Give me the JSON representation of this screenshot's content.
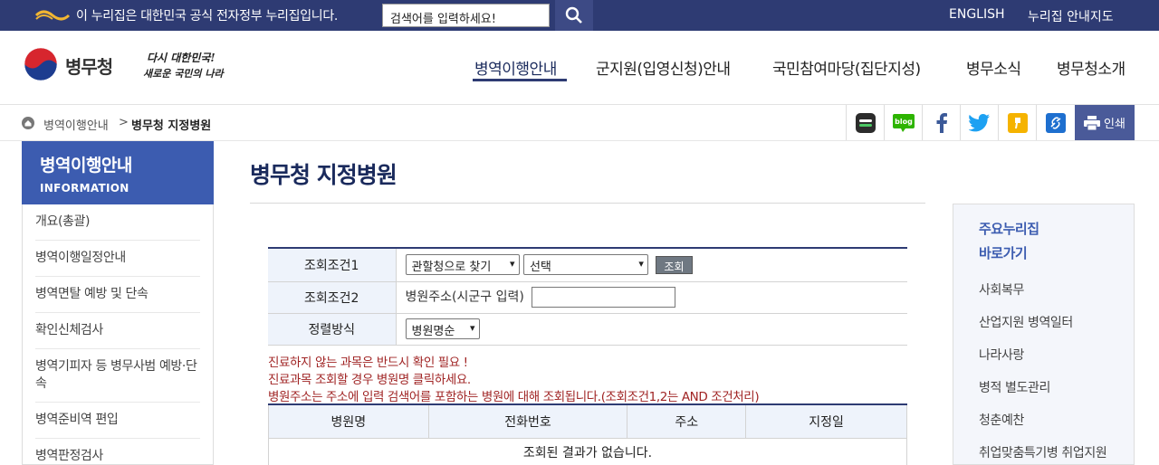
{
  "topbar": {
    "gov_notice": "이 누리집은 대한민국 공식 전자정부 누리집입니다.",
    "search_placeholder": "검색어를 입력하세요!",
    "links": [
      "ENGLISH",
      "누리집 안내지도"
    ]
  },
  "header": {
    "logo_text": "병무청",
    "slogan_line1": "다시 대한민국!",
    "slogan_line2": "새로운 국민의 나라",
    "gnb": [
      "병역이행안내",
      "군지원(입영신청)안내",
      "국민참여마당(집단지성)",
      "병무소식",
      "병무청소개"
    ]
  },
  "breadcrumb": [
    "병역이행안내",
    ">",
    "병무청 지정병원"
  ],
  "share": {
    "print_label": "인쇄"
  },
  "lnb": {
    "title": "병역이행안내",
    "subtitle": "INFORMATION",
    "items": [
      "개요(총괄)",
      "병역이행일정안내",
      "병역면탈 예방 및 단속",
      "확인신체검사",
      "병역기피자 등 병무사범 예방·단속",
      "병역준비역 편입",
      "병역판정검사"
    ]
  },
  "main": {
    "title": "병무청 지정병원",
    "search": {
      "row1_label": "조회조건1",
      "row1_select1": "관할청으로 찾기",
      "row1_select2": "선택",
      "row1_button": "조회",
      "row2_label": "조회조건2",
      "row2_text": "병원주소(시군구 입력)",
      "row3_label": "정렬방식",
      "row3_select": "병원명순"
    },
    "notices": [
      "진료하지 않는 과목은 반드시 확인 필요 !",
      "진료과목 조회할 경우 병원명 클릭하세요.",
      "병원주소는 주소에 입력 검색어를 포함하는 병원에 대해 조회됩니다.(조회조건1,2는 AND 조건처리)"
    ],
    "result_headers": [
      "병원명",
      "전화번호",
      "주소",
      "지정일"
    ],
    "empty_message": "조회된 결과가 없습니다."
  },
  "quick": {
    "title_line1": "주요누리집",
    "title_line2": "바로가기",
    "items": [
      "사회복무",
      "산업지원 병역일터",
      "나라사랑",
      "병적 별도관리",
      "청춘예찬",
      "취업맞춤특기병 취업지원"
    ]
  },
  "colors": {
    "topbar": "#2e3b73",
    "accent": "#3c5cb0",
    "notice": "#a02424"
  }
}
